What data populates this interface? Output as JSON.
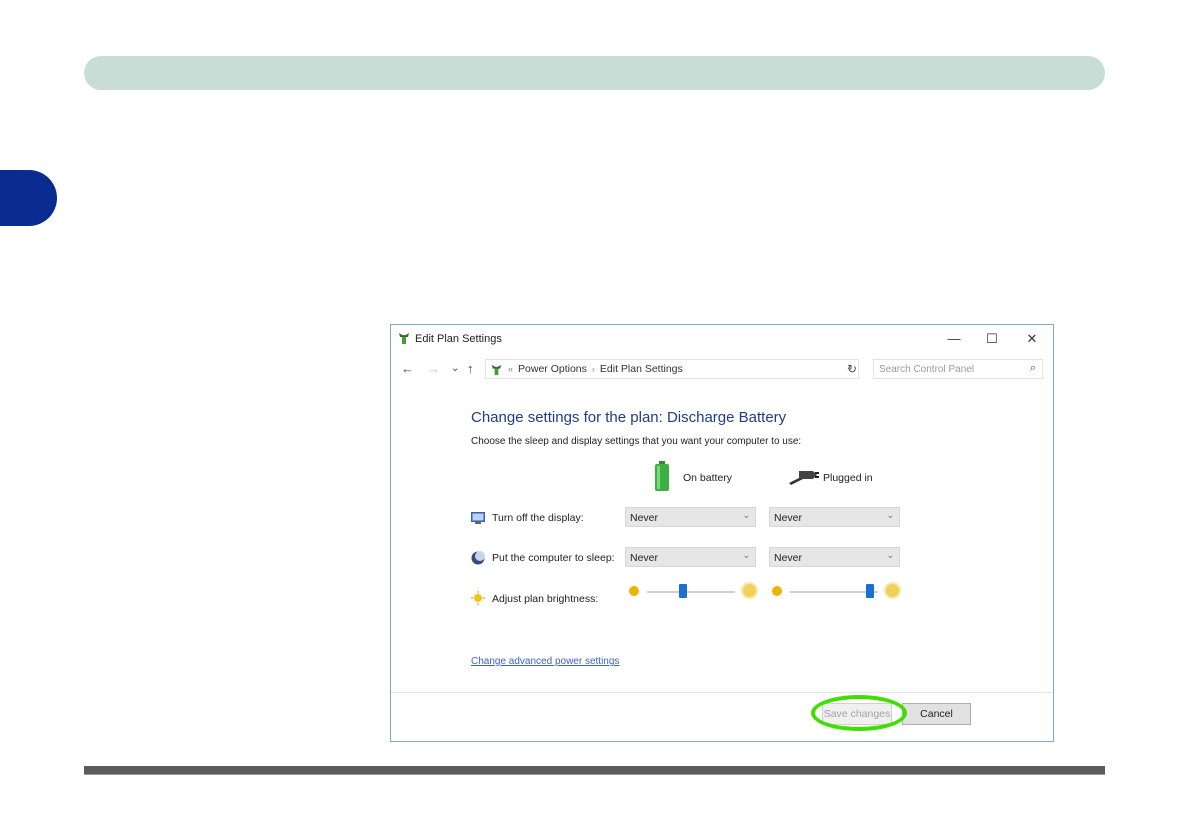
{
  "window": {
    "title": "Edit Plan Settings",
    "controls": {
      "minimize": "—",
      "maximize": "☐",
      "close": "✕"
    }
  },
  "nav": {
    "back": "←",
    "forward": "→",
    "recent": "⌄",
    "up": "↑",
    "refresh": "↻"
  },
  "address": {
    "lead": "«",
    "crumbs": [
      "Power Options",
      "Edit Plan Settings"
    ],
    "separator": "›",
    "dropdown": "⌄"
  },
  "search": {
    "placeholder": "Search Control Panel",
    "icon": "⌕"
  },
  "content": {
    "heading": "Change settings for the plan: Discharge Battery",
    "subheading": "Choose the sleep and display settings that you want your computer to use:",
    "columns": {
      "battery": "On battery",
      "plugged": "Plugged in"
    },
    "rows": {
      "display": {
        "label": "Turn off the display:",
        "battery": "Never",
        "plugged": "Never"
      },
      "sleep": {
        "label": "Put the computer to sleep:",
        "battery": "Never",
        "plugged": "Never"
      },
      "brightness": {
        "label": "Adjust plan brightness:",
        "battery_level": 0.4,
        "plugged_level": 0.95
      }
    },
    "advanced_link": "Change advanced power settings"
  },
  "buttons": {
    "save": "Save changes",
    "cancel": "Cancel"
  },
  "colors": {
    "heading": "#1f3c8c",
    "link": "#3a62c9",
    "highlight": "#3fe000",
    "thumb": "#1a6fd1"
  }
}
